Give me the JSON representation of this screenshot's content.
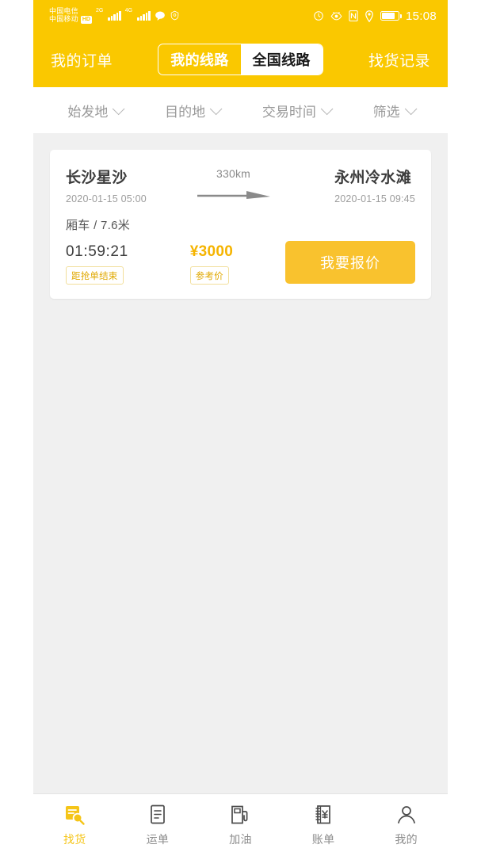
{
  "theme": {
    "brand_yellow": "#FAC800",
    "button_yellow": "#F9C22E",
    "price_yellow": "#F5B400",
    "active_tab_yellow": "#F5C518",
    "page_bg": "#f0f0f0"
  },
  "status_bar": {
    "carrier_primary": "中国电信",
    "carrier_secondary": "中国移动",
    "hd_badge": "HD",
    "network_1": "2G",
    "network_2": "4G",
    "time": "15:08",
    "icons": [
      "signal-bars-icon",
      "signal-bars-icon",
      "message-icon",
      "shield-icon",
      "alarm-icon",
      "eye-icon",
      "nfc-icon",
      "location-pin-icon",
      "battery-icon"
    ]
  },
  "header": {
    "left_link": "我的订单",
    "right_link": "找货记录",
    "segments": [
      {
        "label": "我的线路",
        "active": false
      },
      {
        "label": "全国线路",
        "active": true
      }
    ]
  },
  "filters": [
    {
      "label": "始发地",
      "icon": "chevron-down-icon"
    },
    {
      "label": "目的地",
      "icon": "chevron-down-icon"
    },
    {
      "label": "交易时间",
      "icon": "chevron-down-icon"
    },
    {
      "label": "筛选",
      "icon": "chevron-down-icon"
    }
  ],
  "cards": [
    {
      "origin_city": "长沙星沙",
      "origin_time": "2020-01-15 05:00",
      "distance": "330km",
      "dest_city": "永州冷水滩",
      "dest_time": "2020-01-15 09:45",
      "vehicle": "厢车 / 7.6米",
      "countdown": "01:59:21",
      "countdown_badge": "距抢单结束",
      "price": "¥3000",
      "price_badge": "参考价",
      "action_label": "我要报价"
    }
  ],
  "tabbar": [
    {
      "label": "找货",
      "icon": "doc-search-icon",
      "active": true
    },
    {
      "label": "运单",
      "icon": "document-icon",
      "active": false
    },
    {
      "label": "加油",
      "icon": "fuel-pump-icon",
      "active": false
    },
    {
      "label": "账单",
      "icon": "notebook-yuan-icon",
      "active": false
    },
    {
      "label": "我的",
      "icon": "person-icon",
      "active": false
    }
  ]
}
